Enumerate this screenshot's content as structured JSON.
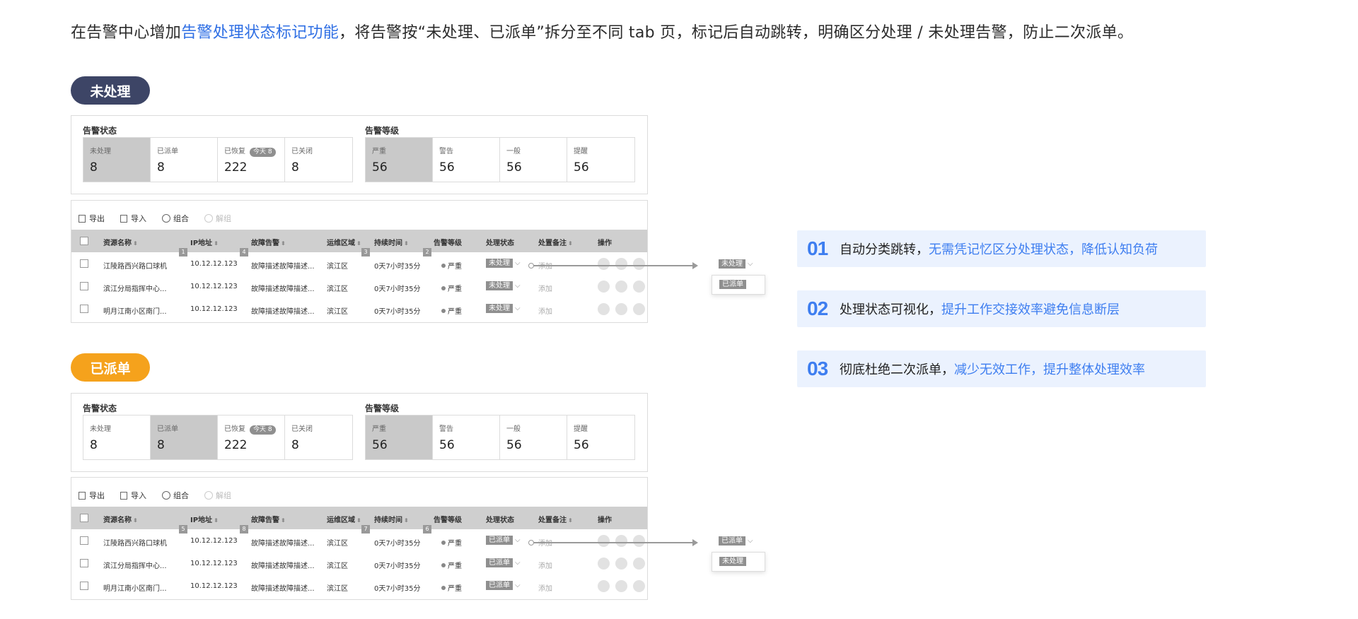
{
  "intro": {
    "prefix": "在告警中心增加",
    "highlight": "告警处理状态标记功能",
    "suffix": "，将告警按“未处理、已派单”拆分至不同 tab 页，标记后自动跳转，明确区分处理 / 未处理告警，防止二次派单。"
  },
  "colors": {
    "accent_blue": "#3e7ef0",
    "badge_navy": "#3d4566",
    "badge_orange": "#f5a21c"
  },
  "sections": [
    {
      "badge": "未处理",
      "status_group_title": "告警状态",
      "level_group_title": "告警等级",
      "status_cards": [
        {
          "label": "未处理",
          "value": "8",
          "selected": true
        },
        {
          "label": "已派单",
          "value": "8",
          "selected": false
        },
        {
          "label": "已恢复",
          "value": "222",
          "pill": "今天 8",
          "selected": false
        },
        {
          "label": "已关闭",
          "value": "8",
          "selected": false
        }
      ],
      "level_cards": [
        {
          "label": "严重",
          "value": "56",
          "selected": true
        },
        {
          "label": "警告",
          "value": "56",
          "selected": false
        },
        {
          "label": "一般",
          "value": "56",
          "selected": false
        },
        {
          "label": "提醒",
          "value": "56",
          "selected": false
        }
      ],
      "toolbar": {
        "export": "导出",
        "import": "导入",
        "combine": "组合",
        "split": "解组"
      },
      "columns": [
        "资源名称",
        "IP地址",
        "故障告警",
        "运维区域",
        "持续时间",
        "告警等级",
        "处理状态",
        "处置备注",
        "操作"
      ],
      "col_tags": [
        "1",
        "4",
        "3",
        "2"
      ],
      "rows": [
        {
          "name": "江陵路西兴路口球机",
          "ip": "10.12.12.123",
          "fault": "故障描述故障描述...",
          "area": "滨江区",
          "duration": "0天7小时35分",
          "level": "严重",
          "status": "未处理",
          "remark": "添加"
        },
        {
          "name": "滨江分局指挥中心...",
          "ip": "10.12.12.123",
          "fault": "故障描述故障描述...",
          "area": "滨江区",
          "duration": "0天7小时35分",
          "level": "严重",
          "status": "未处理",
          "remark": "添加"
        },
        {
          "name": "明月江南小区南门...",
          "ip": "10.12.12.123",
          "fault": "故障描述故障描述...",
          "area": "滨江区",
          "duration": "0天7小时35分",
          "level": "严重",
          "status": "未处理",
          "remark": "添加"
        }
      ],
      "dropdown": {
        "current": "未处理",
        "option": "已派单"
      }
    },
    {
      "badge": "已派单",
      "status_group_title": "告警状态",
      "level_group_title": "告警等级",
      "status_cards": [
        {
          "label": "未处理",
          "value": "8",
          "selected": false
        },
        {
          "label": "已派单",
          "value": "8",
          "selected": true
        },
        {
          "label": "已恢复",
          "value": "222",
          "pill": "今天 8",
          "selected": false
        },
        {
          "label": "已关闭",
          "value": "8",
          "selected": false
        }
      ],
      "level_cards": [
        {
          "label": "严重",
          "value": "56",
          "selected": true
        },
        {
          "label": "警告",
          "value": "56",
          "selected": false
        },
        {
          "label": "一般",
          "value": "56",
          "selected": false
        },
        {
          "label": "提醒",
          "value": "56",
          "selected": false
        }
      ],
      "toolbar": {
        "export": "导出",
        "import": "导入",
        "combine": "组合",
        "split": "解组"
      },
      "columns": [
        "资源名称",
        "IP地址",
        "故障告警",
        "运维区域",
        "持续时间",
        "告警等级",
        "处理状态",
        "处置备注",
        "操作"
      ],
      "col_tags": [
        "5",
        "8",
        "7",
        "6"
      ],
      "rows": [
        {
          "name": "江陵路西兴路口球机",
          "ip": "10.12.12.123",
          "fault": "故障描述故障描述...",
          "area": "滨江区",
          "duration": "0天7小时35分",
          "level": "严重",
          "status": "已派单",
          "remark": "添加"
        },
        {
          "name": "滨江分局指挥中心...",
          "ip": "10.12.12.123",
          "fault": "故障描述故障描述...",
          "area": "滨江区",
          "duration": "0天7小时35分",
          "level": "严重",
          "status": "已派单",
          "remark": "添加"
        },
        {
          "name": "明月江南小区南门...",
          "ip": "10.12.12.123",
          "fault": "故障描述故障描述...",
          "area": "滨江区",
          "duration": "0天7小时35分",
          "level": "严重",
          "status": "已派单",
          "remark": "添加"
        }
      ],
      "dropdown": {
        "current": "已派单",
        "option": "未处理"
      }
    }
  ],
  "benefits": [
    {
      "num": "01",
      "text": "自动分类跳转，",
      "highlight": "无需凭记忆区分处理状态，降低认知负荷"
    },
    {
      "num": "02",
      "text": "处理状态可视化，",
      "highlight": "提升工作交接效率避免信息断层"
    },
    {
      "num": "03",
      "text": "彻底杜绝二次派单，",
      "highlight": "减少无效工作，提升整体处理效率"
    }
  ]
}
